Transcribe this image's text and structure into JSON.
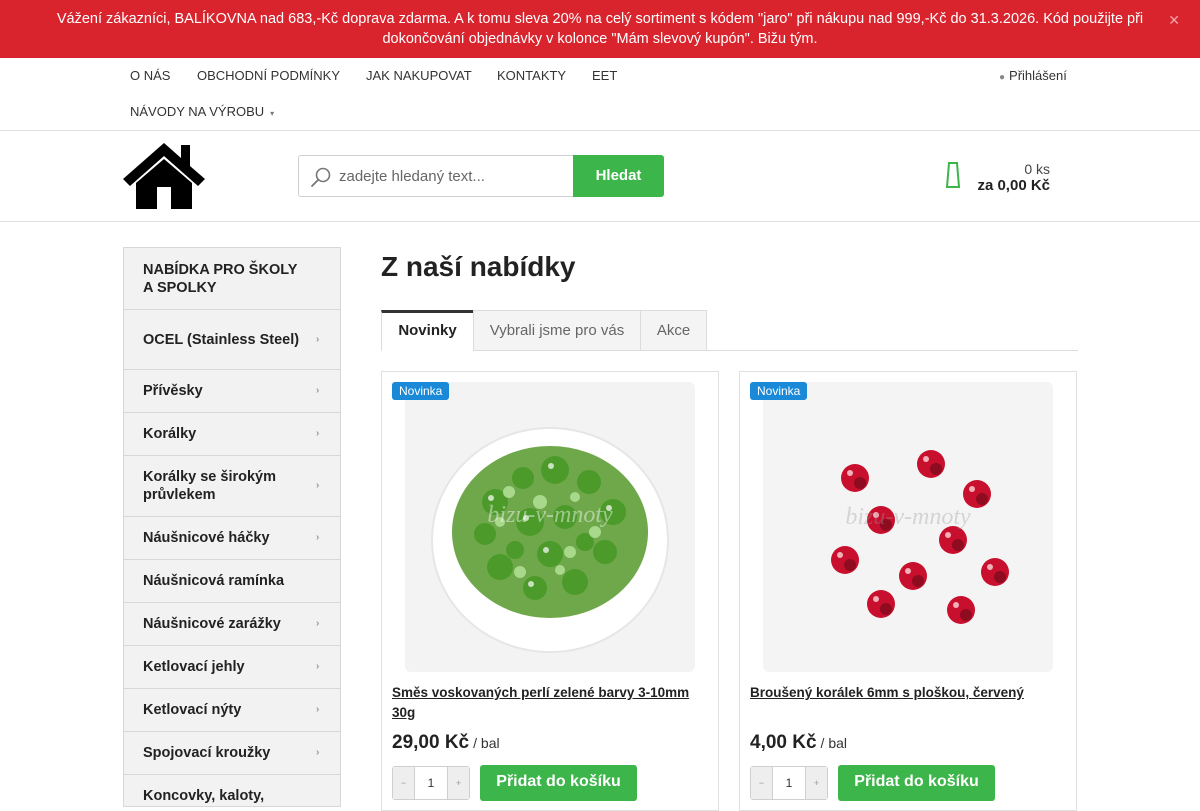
{
  "banner": {
    "text": "Vážení zákazníci, BALÍKOVNA nad 683,-Kč doprava zdarma. A k tomu sleva 20% na celý sortiment s kódem \"jaro\" při nákupu nad 999,-Kč do 31.3.2026. Kód použijte při dokončování objednávky v kolonce \"Mám slevový kupón\". Bižu tým.",
    "close_icon": "close-icon",
    "color": "#d9242e"
  },
  "topnav": {
    "items": [
      {
        "label": "O nás"
      },
      {
        "label": "Obchodní podmínky"
      },
      {
        "label": "Jak nakupovat"
      },
      {
        "label": "Kontakty"
      },
      {
        "label": "EET"
      },
      {
        "label": "Návody na výrobu"
      }
    ],
    "login_label": "Přihlášení"
  },
  "search": {
    "placeholder": "zadejte hledaný text...",
    "button_label": "Hledat"
  },
  "cart": {
    "count": "0 ks",
    "total": "za 0,00 Kč"
  },
  "sidebar": {
    "categories": [
      {
        "label": "NABÍDKA PRO ŠKOLY A SPOLKY",
        "has_submenu": false
      },
      {
        "label": "OCEL (Stainless Steel)",
        "has_submenu": true
      },
      {
        "label": "Přívěsky",
        "has_submenu": true
      },
      {
        "label": "Korálky",
        "has_submenu": true
      },
      {
        "label": "Korálky se širokým průvlekem",
        "has_submenu": true
      },
      {
        "label": "Náušnicové háčky",
        "has_submenu": true
      },
      {
        "label": "Náušnicová ramínka",
        "has_submenu": false
      },
      {
        "label": "Náušnicové zarážky",
        "has_submenu": true
      },
      {
        "label": "Ketlovací jehly",
        "has_submenu": true
      },
      {
        "label": "Ketlovací nýty",
        "has_submenu": true
      },
      {
        "label": "Spojovací kroužky",
        "has_submenu": true
      },
      {
        "label": "Koncovky, kaloty,",
        "has_submenu": false
      }
    ]
  },
  "main": {
    "title": "Z naší nabídky",
    "tabs": [
      {
        "label": "Novinky",
        "active": true
      },
      {
        "label": "Vybrali jsme pro vás",
        "active": false
      },
      {
        "label": "Akce",
        "active": false
      }
    ],
    "products": [
      {
        "badge": "Novinka",
        "name": "Směs voskovaných perlí zelené barvy 3-10mm 30g",
        "price": "29,00 Kč",
        "unit": "/ bal",
        "qty": "1",
        "add_label": "Přidat do košíku",
        "image_watermark": "bizu-v-mnoty",
        "image_color": "#4c9a2a"
      },
      {
        "badge": "Novinka",
        "name": "Broušený korálek 6mm s ploškou, červený",
        "price": "4,00 Kč",
        "unit": "/ bal",
        "qty": "1",
        "add_label": "Přidat do košíku",
        "image_watermark": "bizu-v-mnoty",
        "image_color": "#c8102e"
      }
    ]
  },
  "colors": {
    "accent_green": "#3cb54a",
    "badge_blue": "#1a8ad8"
  }
}
